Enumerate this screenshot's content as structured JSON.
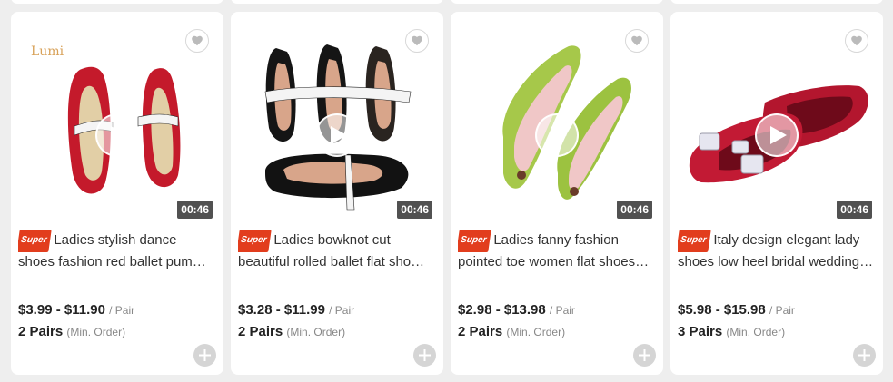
{
  "products": [
    {
      "badge": "Super",
      "title_line1": "Ladies stylish dance",
      "title_line2": "shoes fashion red ballet pum…",
      "price": "$3.99 - $11.90",
      "unit": "/ Pair",
      "moq": "2 Pairs",
      "moq_note": "(Min. Order)",
      "duration": "00:46",
      "brand": "Lumi",
      "image_icon": "red-ballet-flats"
    },
    {
      "badge": "Super",
      "title_line1": "Ladies bowknot cut",
      "title_line2": "beautiful rolled ballet flat sho…",
      "price": "$3.28 - $11.99",
      "unit": "/ Pair",
      "moq": "2 Pairs",
      "moq_note": "(Min. Order)",
      "duration": "00:46",
      "image_icon": "black-mesh-flats"
    },
    {
      "badge": "Super",
      "title_line1": "Ladies fanny fashion",
      "title_line2": "pointed toe women flat shoes…",
      "price": "$2.98 - $13.98",
      "unit": "/ Pair",
      "moq": "2 Pairs",
      "moq_note": "(Min. Order)",
      "duration": "00:46",
      "image_icon": "floral-ballet-flats"
    },
    {
      "badge": "Super",
      "title_line1": "Italy design elegant lady",
      "title_line2": "shoes low heel bridal wedding…",
      "price": "$5.98 - $15.98",
      "unit": "/ Pair",
      "moq": "3 Pairs",
      "moq_note": "(Min. Order)",
      "duration": "00:46",
      "image_icon": "red-satin-pointed-flats"
    }
  ],
  "colors": {
    "badge_bg": "#e23d1d",
    "price_text": "#222222",
    "muted_text": "#888888"
  }
}
